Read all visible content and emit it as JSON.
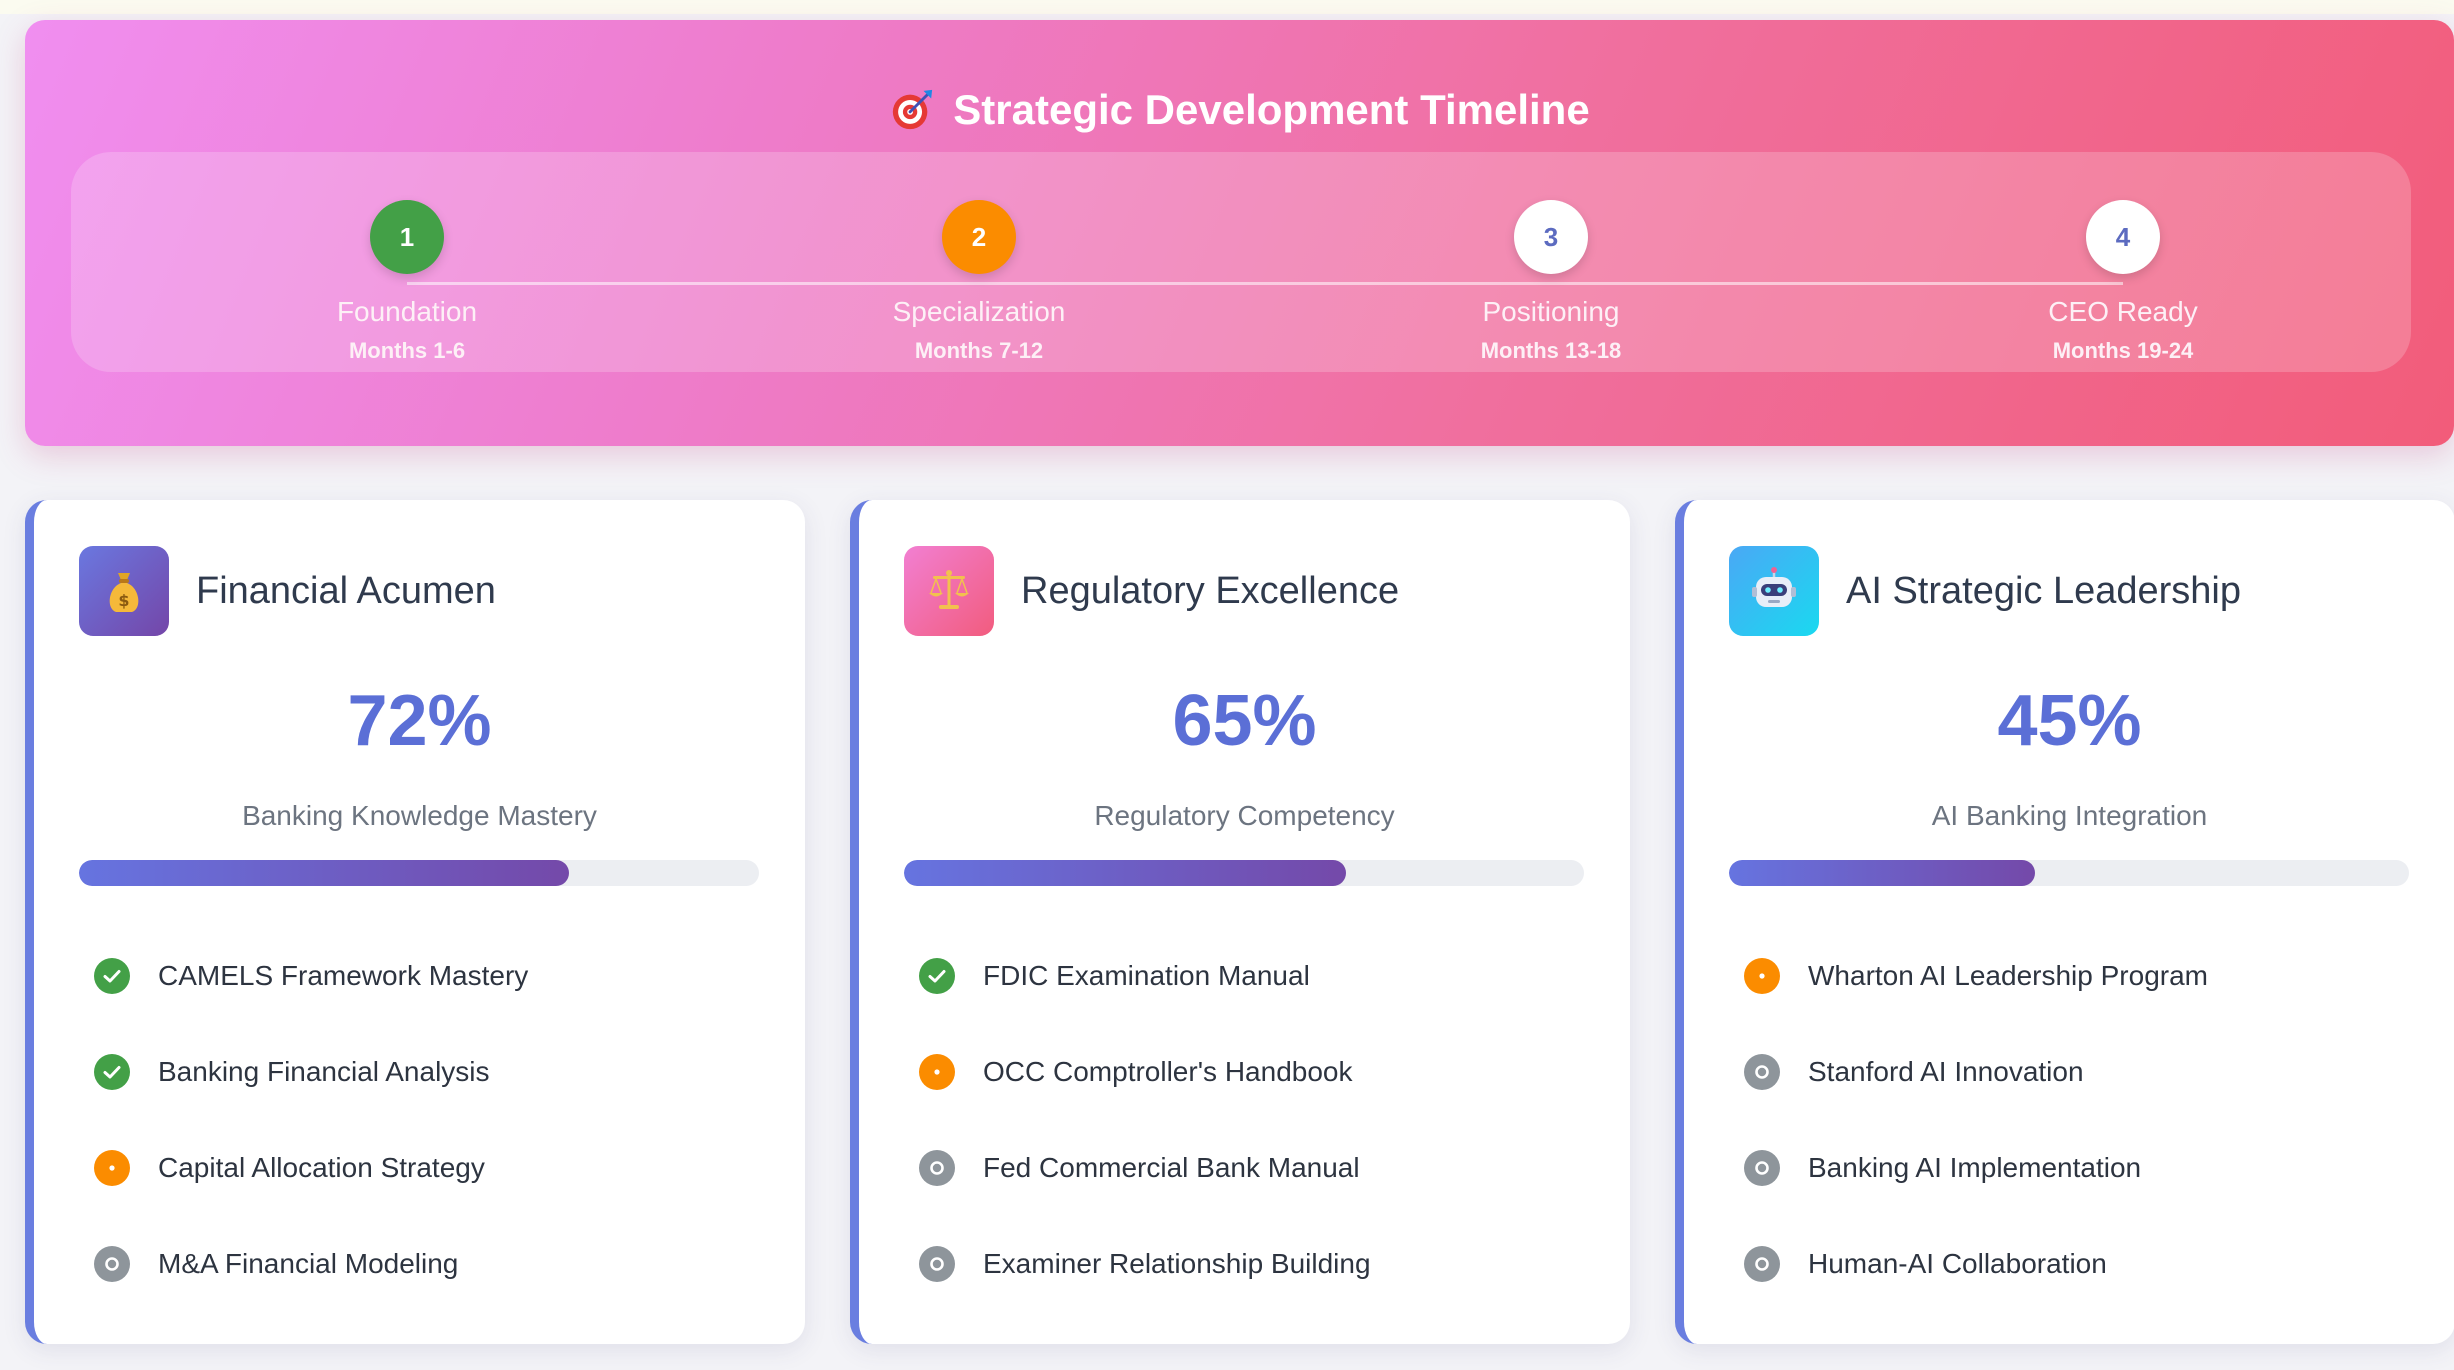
{
  "timeline": {
    "title": "Strategic Development Timeline",
    "icon": "target-icon",
    "steps": [
      {
        "number": "1",
        "name": "Foundation",
        "months": "Months 1-6",
        "status": "done",
        "color": "#43a047"
      },
      {
        "number": "2",
        "name": "Specialization",
        "months": "Months 7-12",
        "status": "active",
        "color": "#fb8c00"
      },
      {
        "number": "3",
        "name": "Positioning",
        "months": "Months 13-18",
        "status": "pending",
        "color": "#ffffff"
      },
      {
        "number": "4",
        "name": "CEO Ready",
        "months": "Months 19-24",
        "status": "pending",
        "color": "#ffffff"
      }
    ]
  },
  "cards": [
    {
      "title": "Financial Acumen",
      "icon": "money-bag-icon",
      "percent": "72%",
      "progress": 72,
      "label": "Banking Knowledge Mastery",
      "items": [
        {
          "text": "CAMELS Framework Mastery",
          "status": "done"
        },
        {
          "text": "Banking Financial Analysis",
          "status": "done"
        },
        {
          "text": "Capital Allocation Strategy",
          "status": "progress"
        },
        {
          "text": "M&A Financial Modeling",
          "status": "todo"
        }
      ]
    },
    {
      "title": "Regulatory Excellence",
      "icon": "balance-scale-icon",
      "percent": "65%",
      "progress": 65,
      "label": "Regulatory Competency",
      "items": [
        {
          "text": "FDIC Examination Manual",
          "status": "done"
        },
        {
          "text": "OCC Comptroller's Handbook",
          "status": "progress"
        },
        {
          "text": "Fed Commercial Bank Manual",
          "status": "todo"
        },
        {
          "text": "Examiner Relationship Building",
          "status": "todo"
        }
      ]
    },
    {
      "title": "AI Strategic Leadership",
      "icon": "robot-icon",
      "percent": "45%",
      "progress": 45,
      "label": "AI Banking Integration",
      "items": [
        {
          "text": "Wharton AI Leadership Program",
          "status": "progress"
        },
        {
          "text": "Stanford AI Innovation",
          "status": "todo"
        },
        {
          "text": "Banking AI Implementation",
          "status": "todo"
        },
        {
          "text": "Human-AI Collaboration",
          "status": "todo"
        }
      ]
    }
  ],
  "colors": {
    "accent": "#5b6fd6",
    "done": "#43a047",
    "in_progress": "#fb8c00",
    "not_started": "#8e959b"
  }
}
